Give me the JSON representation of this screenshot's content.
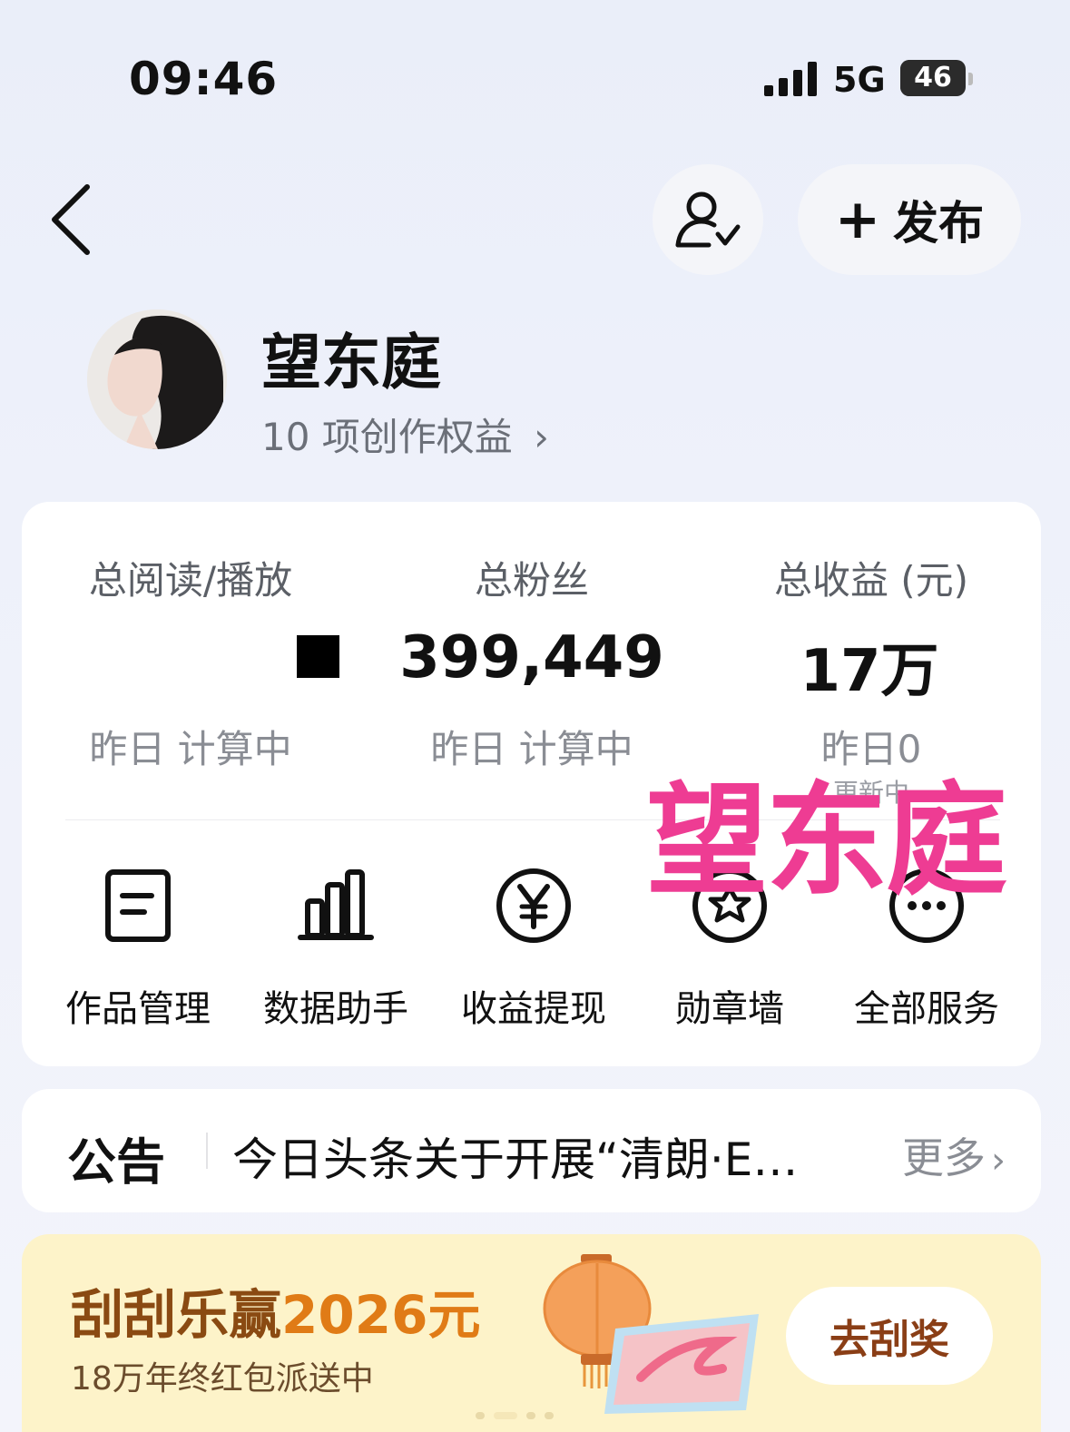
{
  "status_bar": {
    "time": "09:46",
    "network": "5G",
    "battery": "46",
    "battery_level": 0.46
  },
  "header": {
    "publish_label": "发布"
  },
  "profile": {
    "name": "望东庭",
    "benefits": "10 项创作权益"
  },
  "stats": [
    {
      "label": "总阅读/播放",
      "value": "",
      "sub": "昨日 计算中"
    },
    {
      "label": "总粉丝",
      "value": "399,449",
      "sub": "昨日 计算中"
    },
    {
      "label": "总收益 (元)",
      "value": "17万",
      "sub": "昨日0",
      "sub2": "更新中"
    }
  ],
  "services": [
    {
      "label": "作品管理",
      "icon": "document-icon"
    },
    {
      "label": "数据助手",
      "icon": "bar-chart-icon"
    },
    {
      "label": "收益提现",
      "icon": "yen-circle-icon"
    },
    {
      "label": "勋章墙",
      "icon": "badge-star-icon"
    },
    {
      "label": "全部服务",
      "icon": "more-circle-icon"
    }
  ],
  "watermark": "望东庭",
  "notice": {
    "tag": "公告",
    "text": "今日头条关于开展“清朗·E…",
    "more": "更多"
  },
  "promo": {
    "title_prefix": "刮刮乐赢",
    "title_highlight": "2026元",
    "subtitle": "18万年终红包派送中",
    "button": "去刮奖"
  }
}
